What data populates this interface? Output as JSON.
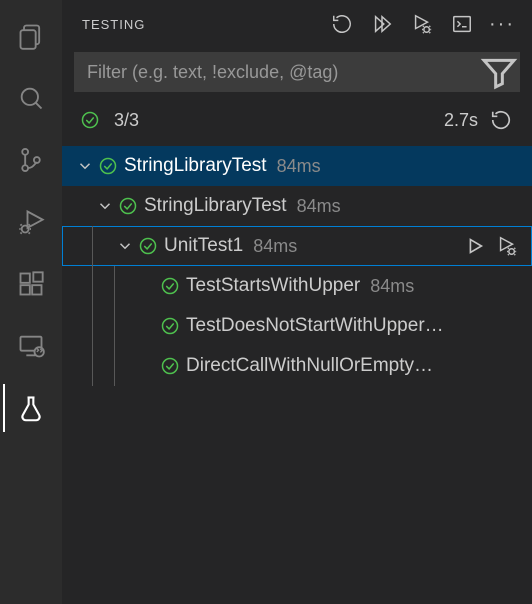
{
  "panel": {
    "title": "TESTING"
  },
  "filter": {
    "placeholder": "Filter (e.g. text, !exclude, @tag)",
    "value": ""
  },
  "summary": {
    "count_text": "3/3",
    "duration": "2.7s"
  },
  "tree": {
    "root": {
      "label": "StringLibraryTest",
      "time": "84ms"
    },
    "ns": {
      "label": "StringLibraryTest",
      "time": "84ms"
    },
    "cls": {
      "label": "UnitTest1",
      "time": "84ms"
    },
    "tests": [
      {
        "label": "TestStartsWithUpper",
        "time": "84ms"
      },
      {
        "label": "TestDoesNotStartWithUpper…",
        "time": ""
      },
      {
        "label": "DirectCallWithNullOrEmpty…",
        "time": ""
      }
    ]
  },
  "icons": {
    "refresh": "refresh-icon",
    "run_all": "play-all-icon",
    "debug_all": "play-bug-icon",
    "terminal": "terminal-icon",
    "filter": "funnel-icon",
    "play": "play-icon",
    "debug": "play-bug-icon"
  }
}
